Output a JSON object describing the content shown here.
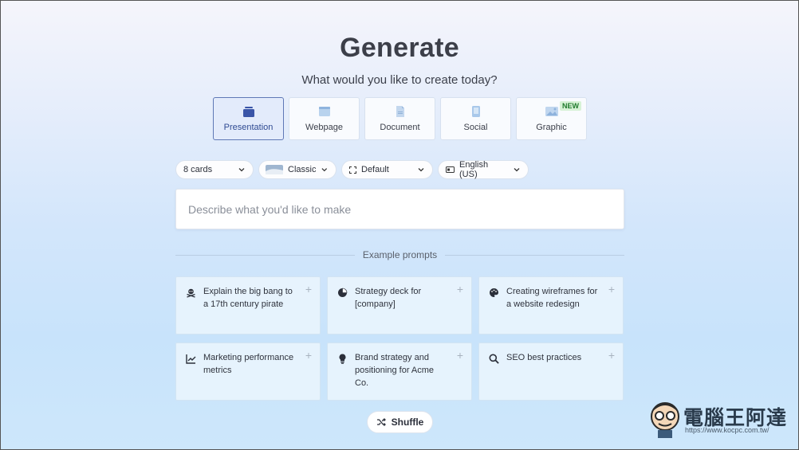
{
  "header": {
    "title": "Generate",
    "subtitle": "What would you like to create today?"
  },
  "types": [
    {
      "label": "Presentation",
      "icon": "presentation-icon",
      "active": true
    },
    {
      "label": "Webpage",
      "icon": "webpage-icon"
    },
    {
      "label": "Document",
      "icon": "document-icon"
    },
    {
      "label": "Social",
      "icon": "social-icon"
    },
    {
      "label": "Graphic",
      "icon": "graphic-icon",
      "badge": "NEW"
    }
  ],
  "controls": {
    "cards": "8 cards",
    "theme": "Classic",
    "layout": "Default",
    "language": "English (US)"
  },
  "prompt": {
    "placeholder": "Describe what you'd like to make",
    "value": ""
  },
  "examples_label": "Example prompts",
  "examples": [
    {
      "text": "Explain the big bang to a 17th century pirate",
      "icon": "pirate-icon"
    },
    {
      "text": "Strategy deck for [company]",
      "icon": "pie-chart-icon"
    },
    {
      "text": "Creating wireframes for a website redesign",
      "icon": "palette-icon"
    },
    {
      "text": "Marketing performance metrics",
      "icon": "line-chart-icon"
    },
    {
      "text": "Brand strategy and positioning for Acme Co.",
      "icon": "lightbulb-icon"
    },
    {
      "text": "SEO best practices",
      "icon": "search-icon"
    }
  ],
  "shuffle_label": "Shuffle",
  "watermark": {
    "name": "電腦王阿達",
    "url": "https://www.kocpc.com.tw/"
  },
  "colors": {
    "accent": "#5f78b6",
    "accent_text": "#2f4a92",
    "new_badge_bg": "#d7f2d6",
    "new_badge_text": "#1f7a2c"
  }
}
